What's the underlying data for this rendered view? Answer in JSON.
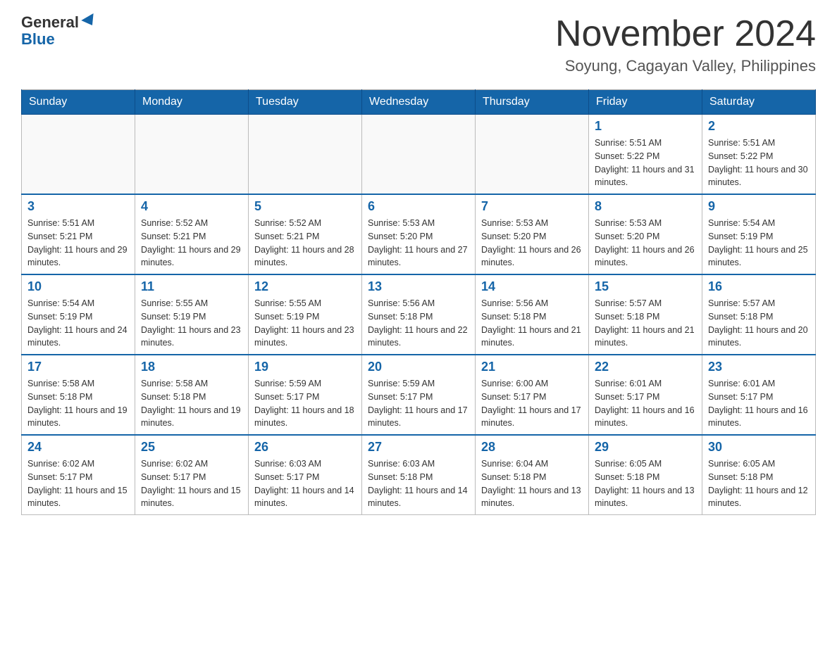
{
  "header": {
    "logo_general": "General",
    "logo_blue": "Blue",
    "main_title": "November 2024",
    "subtitle": "Soyung, Cagayan Valley, Philippines"
  },
  "calendar": {
    "days_of_week": [
      "Sunday",
      "Monday",
      "Tuesday",
      "Wednesday",
      "Thursday",
      "Friday",
      "Saturday"
    ],
    "weeks": [
      [
        {
          "day": "",
          "info": ""
        },
        {
          "day": "",
          "info": ""
        },
        {
          "day": "",
          "info": ""
        },
        {
          "day": "",
          "info": ""
        },
        {
          "day": "",
          "info": ""
        },
        {
          "day": "1",
          "info": "Sunrise: 5:51 AM\nSunset: 5:22 PM\nDaylight: 11 hours and 31 minutes."
        },
        {
          "day": "2",
          "info": "Sunrise: 5:51 AM\nSunset: 5:22 PM\nDaylight: 11 hours and 30 minutes."
        }
      ],
      [
        {
          "day": "3",
          "info": "Sunrise: 5:51 AM\nSunset: 5:21 PM\nDaylight: 11 hours and 29 minutes."
        },
        {
          "day": "4",
          "info": "Sunrise: 5:52 AM\nSunset: 5:21 PM\nDaylight: 11 hours and 29 minutes."
        },
        {
          "day": "5",
          "info": "Sunrise: 5:52 AM\nSunset: 5:21 PM\nDaylight: 11 hours and 28 minutes."
        },
        {
          "day": "6",
          "info": "Sunrise: 5:53 AM\nSunset: 5:20 PM\nDaylight: 11 hours and 27 minutes."
        },
        {
          "day": "7",
          "info": "Sunrise: 5:53 AM\nSunset: 5:20 PM\nDaylight: 11 hours and 26 minutes."
        },
        {
          "day": "8",
          "info": "Sunrise: 5:53 AM\nSunset: 5:20 PM\nDaylight: 11 hours and 26 minutes."
        },
        {
          "day": "9",
          "info": "Sunrise: 5:54 AM\nSunset: 5:19 PM\nDaylight: 11 hours and 25 minutes."
        }
      ],
      [
        {
          "day": "10",
          "info": "Sunrise: 5:54 AM\nSunset: 5:19 PM\nDaylight: 11 hours and 24 minutes."
        },
        {
          "day": "11",
          "info": "Sunrise: 5:55 AM\nSunset: 5:19 PM\nDaylight: 11 hours and 23 minutes."
        },
        {
          "day": "12",
          "info": "Sunrise: 5:55 AM\nSunset: 5:19 PM\nDaylight: 11 hours and 23 minutes."
        },
        {
          "day": "13",
          "info": "Sunrise: 5:56 AM\nSunset: 5:18 PM\nDaylight: 11 hours and 22 minutes."
        },
        {
          "day": "14",
          "info": "Sunrise: 5:56 AM\nSunset: 5:18 PM\nDaylight: 11 hours and 21 minutes."
        },
        {
          "day": "15",
          "info": "Sunrise: 5:57 AM\nSunset: 5:18 PM\nDaylight: 11 hours and 21 minutes."
        },
        {
          "day": "16",
          "info": "Sunrise: 5:57 AM\nSunset: 5:18 PM\nDaylight: 11 hours and 20 minutes."
        }
      ],
      [
        {
          "day": "17",
          "info": "Sunrise: 5:58 AM\nSunset: 5:18 PM\nDaylight: 11 hours and 19 minutes."
        },
        {
          "day": "18",
          "info": "Sunrise: 5:58 AM\nSunset: 5:18 PM\nDaylight: 11 hours and 19 minutes."
        },
        {
          "day": "19",
          "info": "Sunrise: 5:59 AM\nSunset: 5:17 PM\nDaylight: 11 hours and 18 minutes."
        },
        {
          "day": "20",
          "info": "Sunrise: 5:59 AM\nSunset: 5:17 PM\nDaylight: 11 hours and 17 minutes."
        },
        {
          "day": "21",
          "info": "Sunrise: 6:00 AM\nSunset: 5:17 PM\nDaylight: 11 hours and 17 minutes."
        },
        {
          "day": "22",
          "info": "Sunrise: 6:01 AM\nSunset: 5:17 PM\nDaylight: 11 hours and 16 minutes."
        },
        {
          "day": "23",
          "info": "Sunrise: 6:01 AM\nSunset: 5:17 PM\nDaylight: 11 hours and 16 minutes."
        }
      ],
      [
        {
          "day": "24",
          "info": "Sunrise: 6:02 AM\nSunset: 5:17 PM\nDaylight: 11 hours and 15 minutes."
        },
        {
          "day": "25",
          "info": "Sunrise: 6:02 AM\nSunset: 5:17 PM\nDaylight: 11 hours and 15 minutes."
        },
        {
          "day": "26",
          "info": "Sunrise: 6:03 AM\nSunset: 5:17 PM\nDaylight: 11 hours and 14 minutes."
        },
        {
          "day": "27",
          "info": "Sunrise: 6:03 AM\nSunset: 5:18 PM\nDaylight: 11 hours and 14 minutes."
        },
        {
          "day": "28",
          "info": "Sunrise: 6:04 AM\nSunset: 5:18 PM\nDaylight: 11 hours and 13 minutes."
        },
        {
          "day": "29",
          "info": "Sunrise: 6:05 AM\nSunset: 5:18 PM\nDaylight: 11 hours and 13 minutes."
        },
        {
          "day": "30",
          "info": "Sunrise: 6:05 AM\nSunset: 5:18 PM\nDaylight: 11 hours and 12 minutes."
        }
      ]
    ]
  }
}
